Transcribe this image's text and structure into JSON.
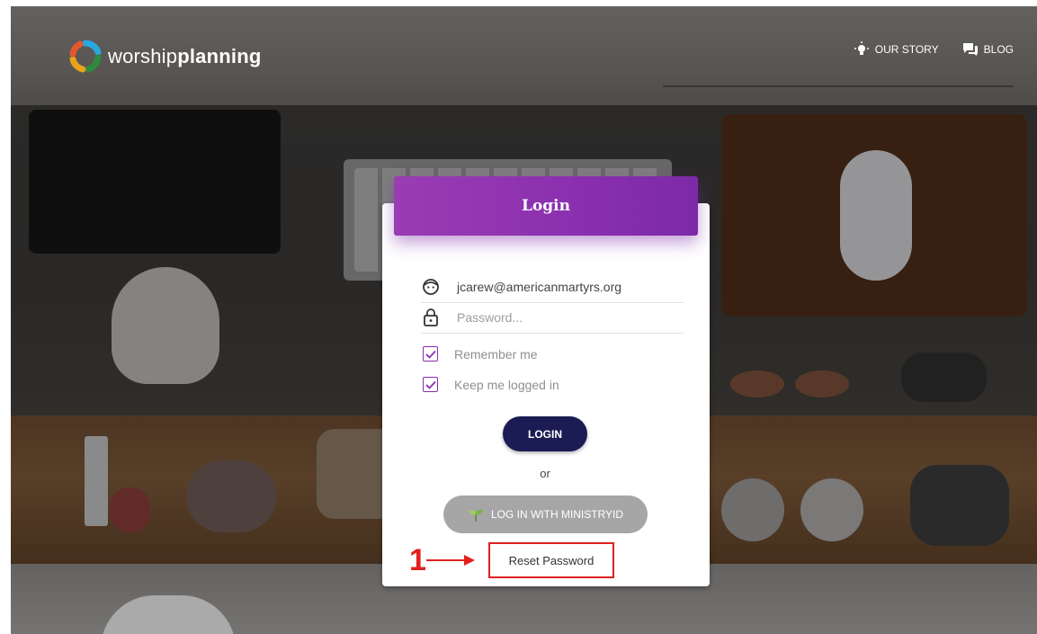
{
  "brand": {
    "name_light": "worship",
    "name_bold": "planning"
  },
  "nav": [
    {
      "label": "OUR STORY",
      "icon": "lightbulb-icon"
    },
    {
      "label": "BLOG",
      "icon": "chat-bubbles-icon"
    }
  ],
  "login": {
    "title": "Login",
    "email": {
      "value": "jcarew@americanmartyrs.org",
      "icon": "user-face-icon"
    },
    "password": {
      "placeholder": "Password...",
      "icon": "lock-icon"
    },
    "remember_me": {
      "label": "Remember me",
      "checked": true
    },
    "keep_logged_in": {
      "label": "Keep me logged in",
      "checked": true
    },
    "login_button": "LOGIN",
    "or_text": "or",
    "ministryid_button": "LOG IN WITH MINISTRYID",
    "reset_password": "Reset Password"
  },
  "annotation": {
    "number": "1"
  },
  "colors": {
    "accent_purple": "#8a2fb0",
    "login_button": "#1c1c54",
    "ministry_button": "#a6a6a6",
    "annotation_red": "#e02020"
  }
}
